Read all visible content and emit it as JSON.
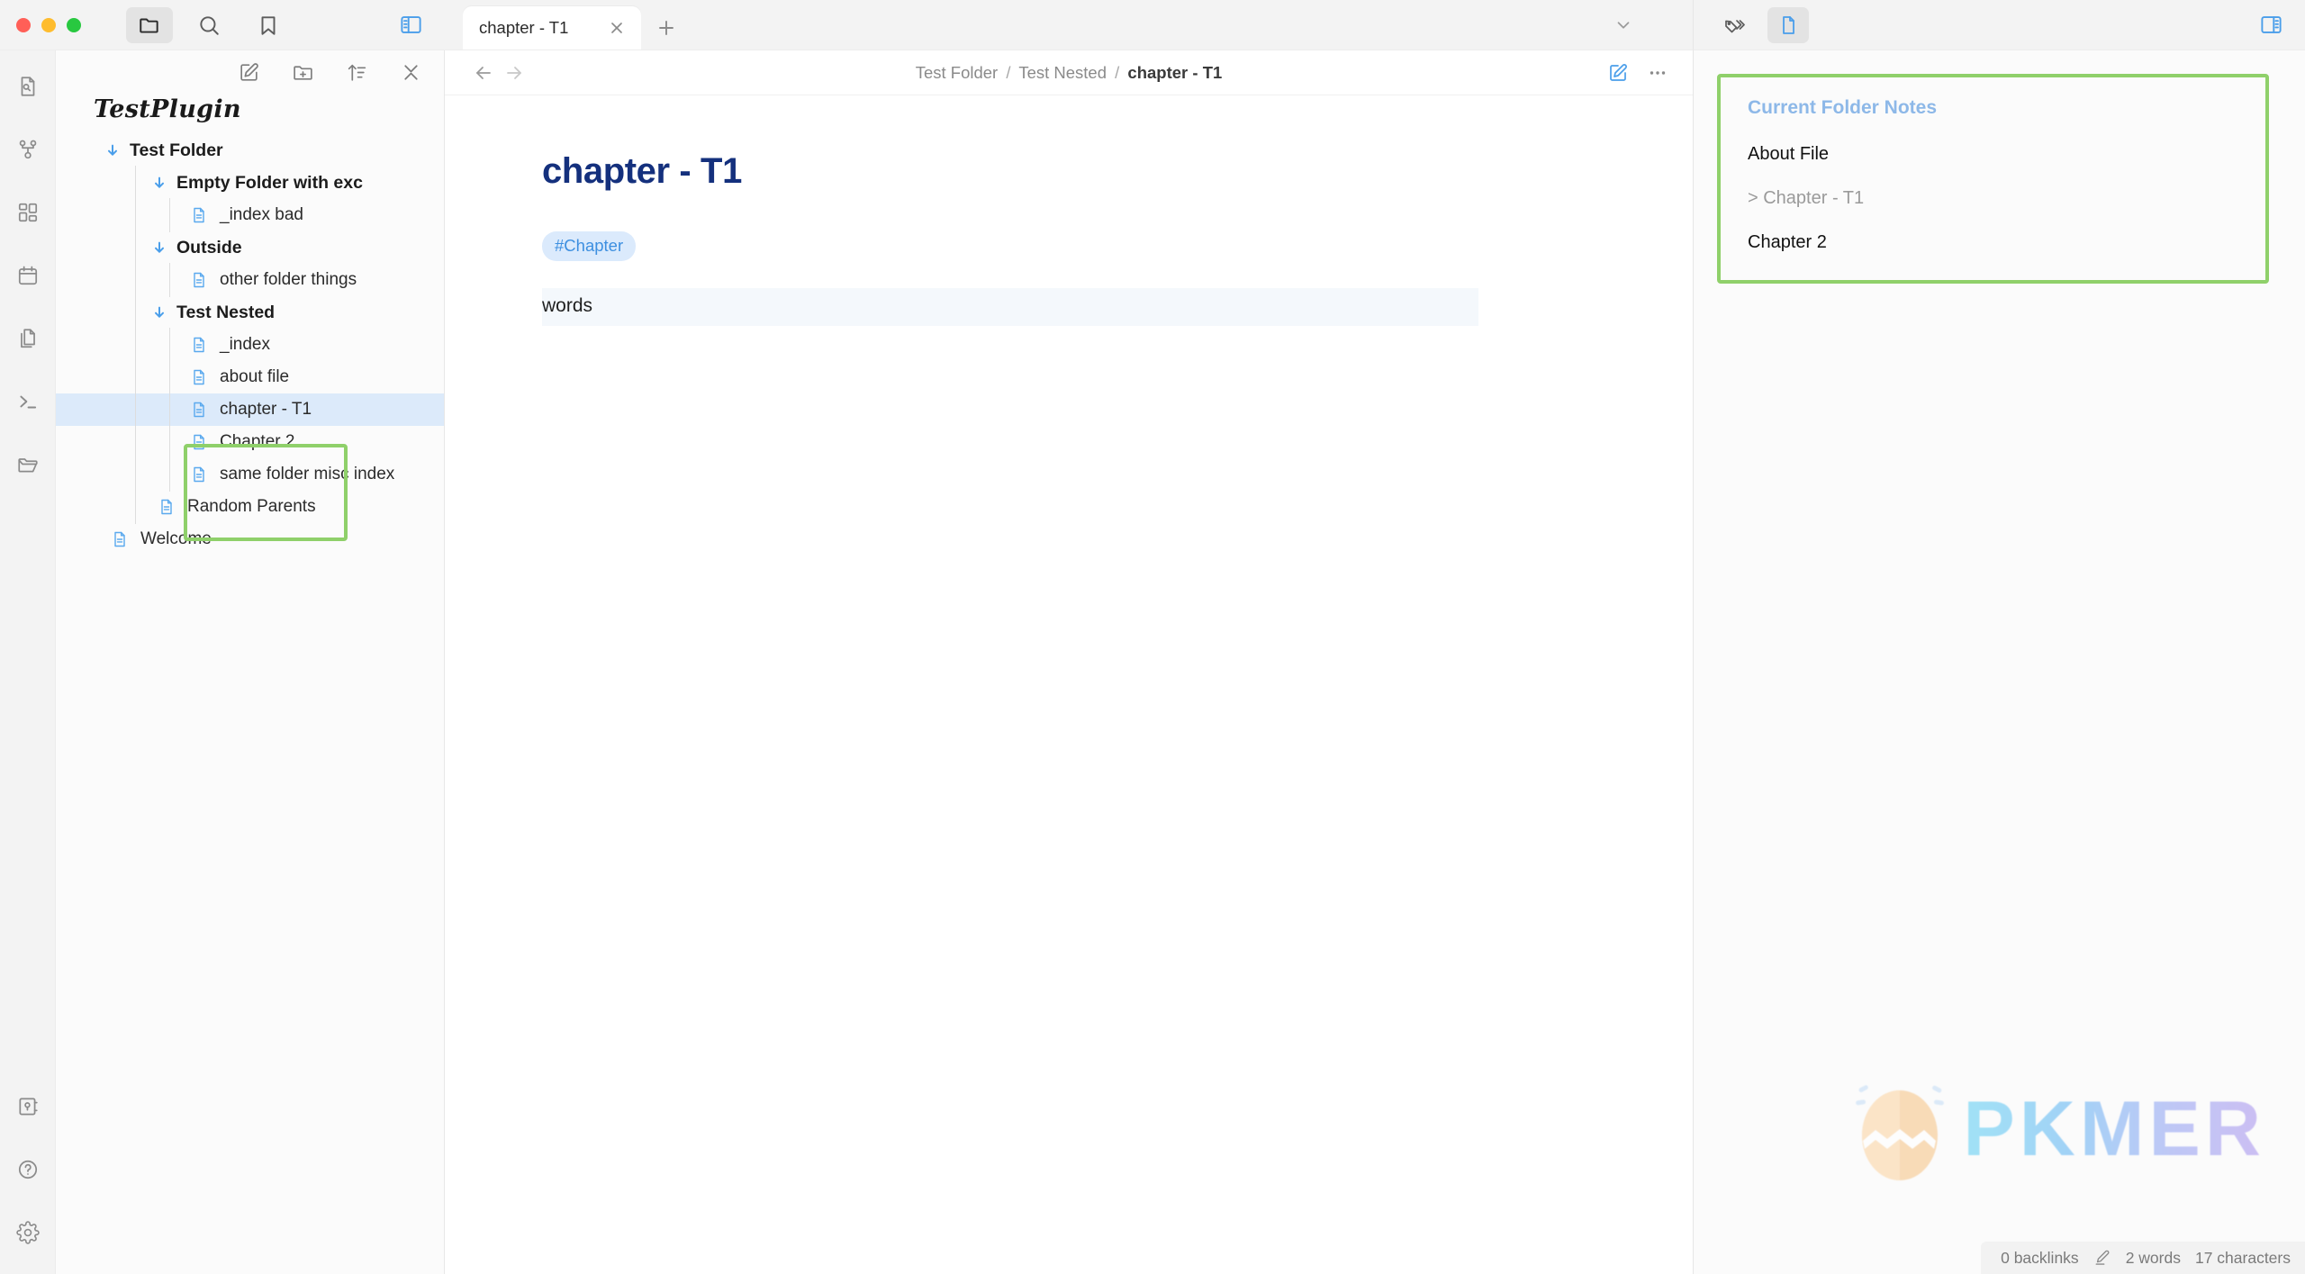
{
  "window": {
    "traffic_lights": [
      "close",
      "minimize",
      "maximize"
    ]
  },
  "titlebar": {
    "left_icons": [
      {
        "name": "folder-icon",
        "label": "Files",
        "active": true
      },
      {
        "name": "search-icon",
        "label": "Search",
        "active": false
      },
      {
        "name": "bookmark-icon",
        "label": "Bookmarks",
        "active": false
      }
    ],
    "left_sidebar_toggle": "left-sidebar-toggle-icon",
    "right_icons": [
      {
        "name": "tags-icon",
        "label": "Tags",
        "active": false
      },
      {
        "name": "page-preview-icon",
        "label": "Page Preview",
        "active": true
      }
    ],
    "right_sidebar_toggle": "right-sidebar-toggle-icon"
  },
  "tabs": {
    "items": [
      {
        "title": "chapter - T1",
        "active": true
      }
    ],
    "close_label": "✕",
    "add_label": "+",
    "chevron_label": "⌄"
  },
  "ribbon": {
    "top_items": [
      {
        "name": "quick-switcher-icon",
        "label": "Quick switcher"
      },
      {
        "name": "graph-view-icon",
        "label": "Graph view"
      },
      {
        "name": "canvas-icon",
        "label": "Canvas"
      },
      {
        "name": "daily-note-icon",
        "label": "Daily note"
      },
      {
        "name": "templates-icon",
        "label": "Templates"
      },
      {
        "name": "terminal-icon",
        "label": "Terminal"
      },
      {
        "name": "open-folder-icon",
        "label": "Open folder"
      }
    ],
    "bottom_items": [
      {
        "name": "vault-switcher-icon",
        "label": "Open another vault"
      },
      {
        "name": "help-icon",
        "label": "Help"
      },
      {
        "name": "settings-icon",
        "label": "Settings"
      }
    ]
  },
  "explorer": {
    "toolbar": [
      {
        "name": "new-note-icon",
        "label": "New note"
      },
      {
        "name": "new-folder-icon",
        "label": "New folder"
      },
      {
        "name": "sort-icon",
        "label": "Change sort order"
      },
      {
        "name": "collapse-all-icon",
        "label": "Collapse all"
      }
    ],
    "vault_name": "TestPlugin",
    "tree": [
      {
        "type": "folder",
        "label": "Test Folder",
        "depth": 0,
        "expanded": true
      },
      {
        "type": "folder",
        "label": "Empty Folder with exc",
        "depth": 1,
        "expanded": true
      },
      {
        "type": "file",
        "label": "_index bad",
        "depth": 2
      },
      {
        "type": "folder",
        "label": "Outside",
        "depth": 1,
        "expanded": true
      },
      {
        "type": "file",
        "label": "other folder things",
        "depth": 2
      },
      {
        "type": "folder",
        "label": "Test Nested",
        "depth": 1,
        "expanded": true
      },
      {
        "type": "file",
        "label": "_index",
        "depth": 2
      },
      {
        "type": "file",
        "label": "about file",
        "depth": 2
      },
      {
        "type": "file",
        "label": "chapter - T1",
        "depth": 2,
        "selected": true
      },
      {
        "type": "file",
        "label": "Chapter 2",
        "depth": 2
      },
      {
        "type": "file",
        "label": "same folder misc index",
        "depth": 2
      },
      {
        "type": "file",
        "label": "Random Parents",
        "depth": 1
      },
      {
        "type": "file",
        "label": "Welcome",
        "depth": 0
      }
    ]
  },
  "view_header": {
    "back_label": "←",
    "forward_label": "→",
    "breadcrumb": {
      "parts": [
        "Test Folder",
        "Test Nested"
      ],
      "current": "chapter - T1",
      "separator": "/"
    },
    "actions": [
      {
        "name": "edit-mode-icon",
        "label": "Edit"
      },
      {
        "name": "more-options-icon",
        "label": "More options"
      }
    ]
  },
  "document": {
    "title": "chapter - T1",
    "tags": [
      "#Chapter"
    ],
    "body": "words"
  },
  "right_panel": {
    "card_title": "Current Folder Notes",
    "notes": [
      {
        "label": "About File",
        "current": false
      },
      {
        "label": "> Chapter - T1",
        "current": true
      },
      {
        "label": "Chapter 2",
        "current": false
      }
    ]
  },
  "watermark": {
    "text": "PKMER"
  },
  "statusbar": {
    "backlinks": "0 backlinks",
    "edit_icon": "pencil-icon",
    "words": "2 words",
    "characters": "17 characters"
  },
  "colors": {
    "accent_blue": "#4a9eea",
    "title_blue": "#14307d",
    "selection_blue": "#dceafa",
    "annotation_green": "#8fd06a",
    "tag_bg": "#dbeafc",
    "tag_text": "#3d8fe0"
  }
}
